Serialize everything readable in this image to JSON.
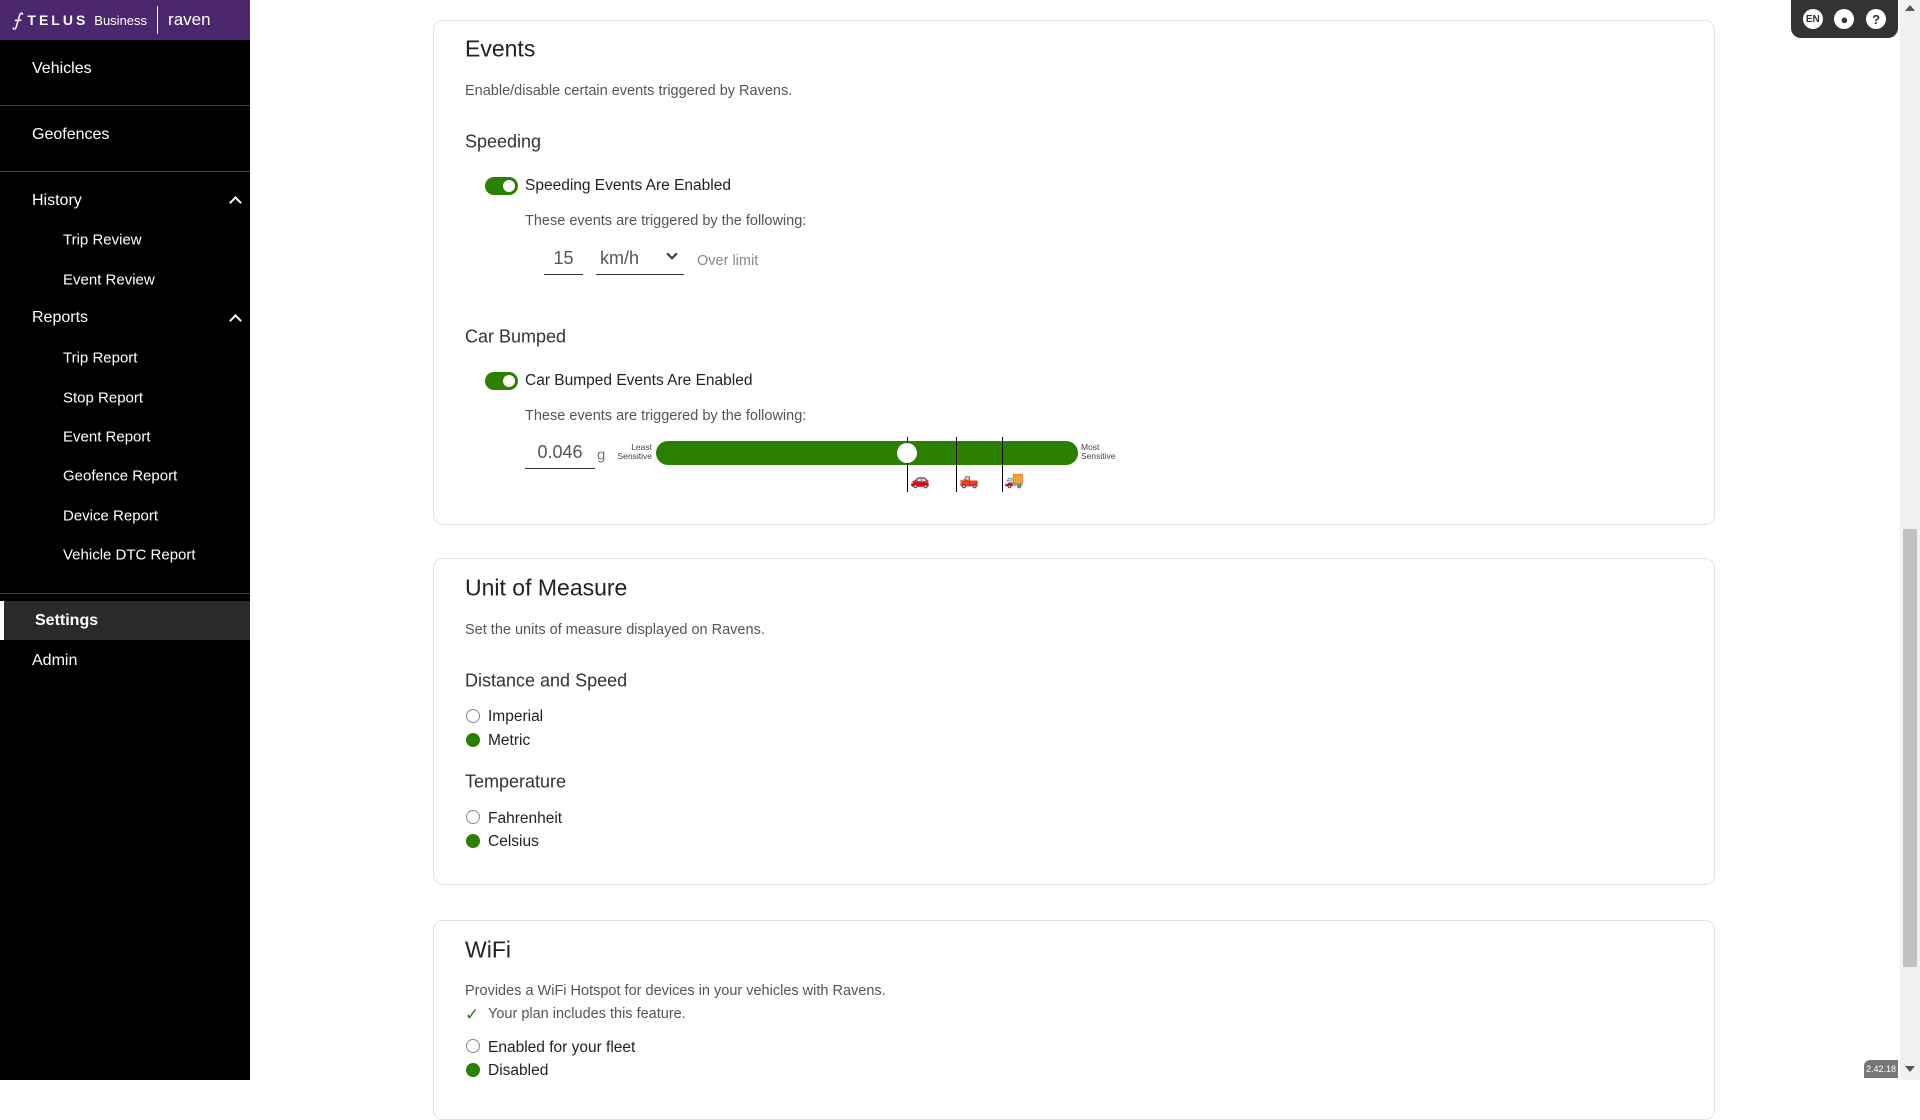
{
  "brand": {
    "logo": "TELUS Business",
    "product": "raven"
  },
  "sidebar": {
    "items": [
      {
        "label": "Vehicles"
      },
      {
        "label": "Geofences"
      },
      {
        "label": "History"
      },
      {
        "label": "Trip Review"
      },
      {
        "label": "Event Review"
      },
      {
        "label": "Reports"
      },
      {
        "label": "Trip Report"
      },
      {
        "label": "Stop Report"
      },
      {
        "label": "Event Report"
      },
      {
        "label": "Geofence Report"
      },
      {
        "label": "Device Report"
      },
      {
        "label": "Vehicle DTC Report"
      },
      {
        "label": "Settings",
        "active": true
      },
      {
        "label": "Admin"
      }
    ]
  },
  "topbar": {
    "language": "EN",
    "icons": [
      "language-icon",
      "account-icon",
      "help-icon"
    ]
  },
  "events": {
    "title": "Events",
    "description": "Enable/disable certain events triggered by Ravens.",
    "speeding": {
      "heading": "Speeding",
      "toggle_label": "Speeding Events Are Enabled",
      "enabled": true,
      "trigger_text": "These events are triggered by the following:",
      "value": "15",
      "unit": "km/h",
      "suffix": "Over limit"
    },
    "bumped": {
      "heading": "Car Bumped",
      "toggle_label": "Car Bumped Events Are Enabled",
      "enabled": true,
      "trigger_text": "These events are triggered by the following:",
      "value": "0.046",
      "unit": "g",
      "least": "Least Sensitive",
      "most": "Most Sensitive",
      "slider_fraction": 0.6,
      "vehicle_markers": [
        "car-icon",
        "pickup-truck-icon",
        "dump-truck-icon"
      ]
    }
  },
  "units": {
    "title": "Unit of Measure",
    "description": "Set the units of measure displayed on Ravens.",
    "distance": {
      "heading": "Distance and Speed",
      "options": [
        "Imperial",
        "Metric"
      ],
      "selected": "Metric"
    },
    "temperature": {
      "heading": "Temperature",
      "options": [
        "Fahrenheit",
        "Celsius"
      ],
      "selected": "Celsius"
    }
  },
  "wifi": {
    "title": "WiFi",
    "description": "Provides a WiFi Hotspot for devices in your vehicles with Ravens.",
    "plan_note": "Your plan includes this feature.",
    "options": [
      "Enabled for your fleet",
      "Disabled"
    ],
    "selected": "Disabled"
  },
  "version": "2.42.18",
  "colors": {
    "accent": "#2b8000",
    "brand": "#4b286d",
    "sidebar": "#000000"
  }
}
